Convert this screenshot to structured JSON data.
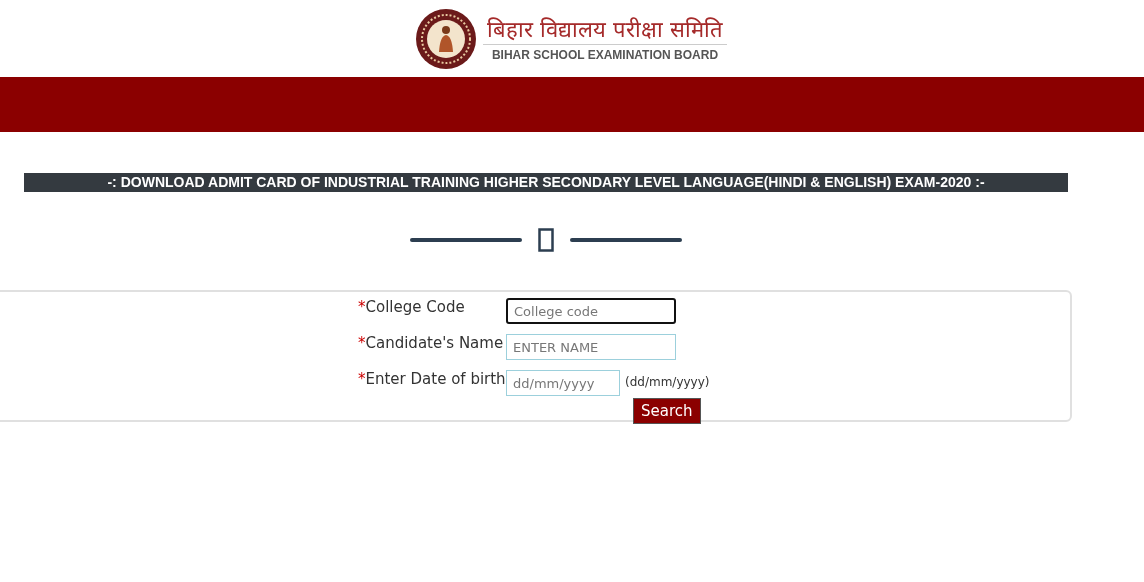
{
  "header": {
    "title_hindi": "बिहार विद्यालय परीक्षा समिति",
    "title_english": "BIHAR SCHOOL EXAMINATION BOARD"
  },
  "banner": {
    "title": "-: DOWNLOAD ADMIT CARD OF INDUSTRIAL TRAINING HIGHER SECONDARY LEVEL LANGUAGE(HINDI & ENGLISH) EXAM-2020 :-"
  },
  "form": {
    "fields": [
      {
        "required_mark": "*",
        "label": "College Code",
        "placeholder": "College code",
        "focused": true
      },
      {
        "required_mark": "*",
        "label": "Candidate's Name",
        "placeholder": "ENTER NAME",
        "focused": false
      },
      {
        "required_mark": "*",
        "label": "Enter Date of birth",
        "placeholder": "dd/mm/yyyy",
        "focused": false,
        "hint": "(dd/mm/yyyy)"
      }
    ],
    "button": "Search"
  }
}
